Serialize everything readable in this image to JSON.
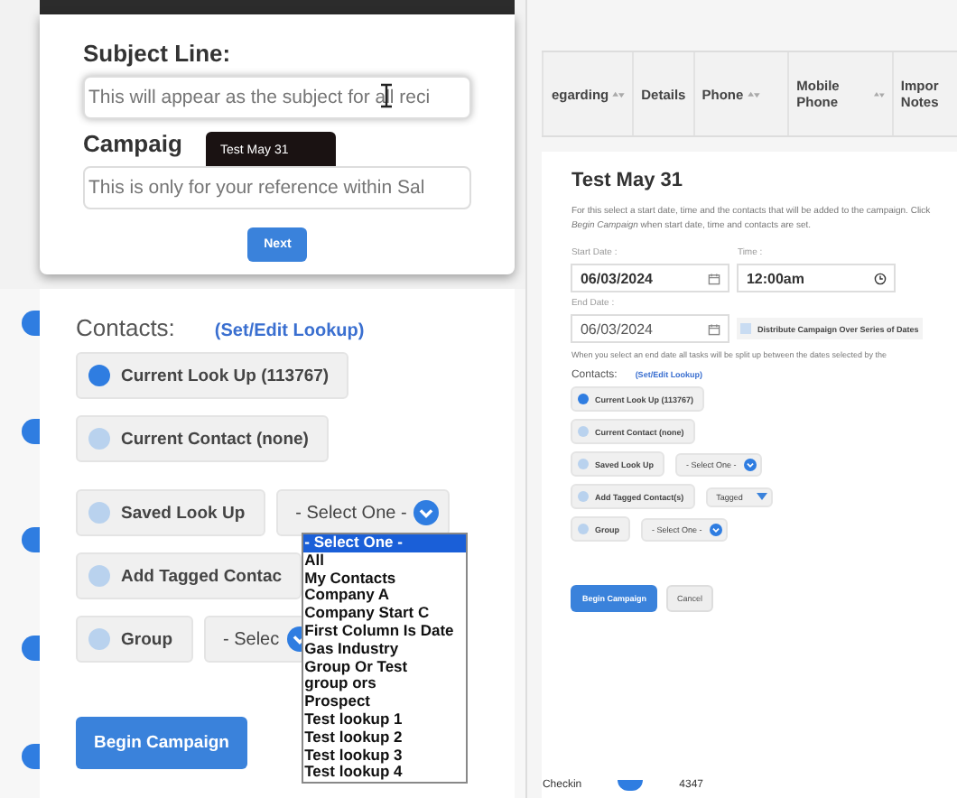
{
  "subject_modal": {
    "subject_label": "Subject Line:",
    "subject_placeholder": "This will appear as the subject for all reci",
    "campaign_label": "Campaig",
    "campaign_placeholder": "This is only for your reference within Sal",
    "tooltip": "Test May 31",
    "next_button": "Next"
  },
  "table": {
    "columns": [
      {
        "label": "egarding",
        "sortable": true
      },
      {
        "label": "Details",
        "sortable": false
      },
      {
        "label": "Phone",
        "sortable": true
      },
      {
        "label": "Mobile Phone",
        "sortable": true
      },
      {
        "label": "Impor Notes",
        "sortable": false
      }
    ],
    "last_row": [
      "Checkin",
      "4347"
    ]
  },
  "campaign_form": {
    "title": "Test May 31",
    "description": "For this select a start date, time and the contacts that will be added to the campaign. Click *Begin Campaign* when start date, time and contacts are set.",
    "start_date_label": "Start Date :",
    "start_date": "06/03/2024",
    "time_label": "Time :",
    "time": "12:00am",
    "end_date_label": "End Date :",
    "end_date": "06/03/2024",
    "distribute": {
      "label": "Distribute Campaign Over Series of Dates",
      "checked": false
    },
    "end_date_note": "When you select an end date all tasks will be split up between the dates selected by the",
    "contacts_label": "Contacts:",
    "lookup_link": "(Set/Edit Lookup)",
    "sources": [
      {
        "kind": "plain",
        "label": "Current Look Up (113767)",
        "selected": true
      },
      {
        "kind": "plain",
        "label": "Current Contact (none)",
        "selected": false
      },
      {
        "kind": "select",
        "label": "Saved Look Up",
        "selected": false,
        "select_value": "- Select One -"
      },
      {
        "kind": "tagged",
        "label": "Add Tagged Contact(s)",
        "selected": false,
        "select_value": "Tagged"
      },
      {
        "kind": "select",
        "label": "Group",
        "selected": false,
        "select_value": "- Select One -"
      }
    ],
    "begin_button": "Begin Campaign",
    "cancel_button": "Cancel"
  },
  "contacts_zoom": {
    "contacts_label": "Contacts:",
    "lookup_link": "(Set/Edit Lookup)",
    "sources": [
      {
        "kind": "plain",
        "label": "Current Look Up (113767)",
        "selected": true
      },
      {
        "kind": "plain",
        "label": "Current Contact (none)",
        "selected": false
      },
      {
        "kind": "select",
        "label": "Saved Look Up",
        "selected": false,
        "select_value": "- Select One -",
        "open": true
      },
      {
        "kind": "plain",
        "label": "Add Tagged Contac",
        "selected": false
      },
      {
        "kind": "select",
        "label": "Group",
        "selected": false,
        "select_value": "- Selec",
        "open": false
      }
    ],
    "dropdown_options": [
      {
        "label": "- Select One -",
        "selected": true
      },
      {
        "label": "All",
        "selected": false
      },
      {
        "label": "My Contacts",
        "selected": false
      },
      {
        "label": "Company A",
        "selected": false
      },
      {
        "label": "Company Start C",
        "selected": false
      },
      {
        "label": "First Column Is Date",
        "selected": false
      },
      {
        "label": "Gas Industry",
        "selected": false
      },
      {
        "label": "Group Or Test",
        "selected": false
      },
      {
        "label": "group ors",
        "selected": false
      },
      {
        "label": "Prospect",
        "selected": false
      },
      {
        "label": "Test lookup 1",
        "selected": false
      },
      {
        "label": "Test lookup 2",
        "selected": false
      },
      {
        "label": "Test lookup 3",
        "selected": false
      },
      {
        "label": "Test lookup 4",
        "selected": false
      }
    ],
    "begin_button": "Begin Campaign"
  }
}
